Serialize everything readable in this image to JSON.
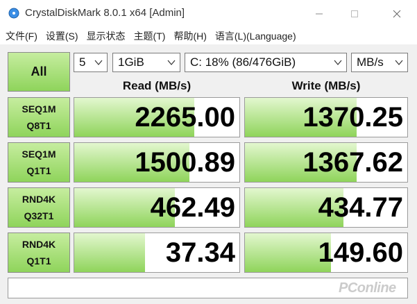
{
  "window": {
    "title": "CrystalDiskMark 8.0.1 x64 [Admin]",
    "icon": "disk-icon"
  },
  "menu": [
    "文件(F)",
    "设置(S)",
    "显示状态",
    "主题(T)",
    "帮助(H)",
    "语言(L)(Language)"
  ],
  "toolbar": {
    "all_label": "All",
    "count": "5",
    "size": "1GiB",
    "drive": "C: 18% (86/476GiB)",
    "unit": "MB/s"
  },
  "headers": {
    "read": "Read (MB/s)",
    "write": "Write (MB/s)"
  },
  "tests": [
    {
      "line1": "SEQ1M",
      "line2": "Q8T1",
      "read": "2265.00",
      "write": "1370.25"
    },
    {
      "line1": "SEQ1M",
      "line2": "Q1T1",
      "read": "1500.89",
      "write": "1367.62"
    },
    {
      "line1": "RND4K",
      "line2": "Q32T1",
      "read": "462.49",
      "write": "434.77"
    },
    {
      "line1": "RND4K",
      "line2": "Q1T1",
      "read": "37.34",
      "write": "149.60"
    }
  ],
  "comment": "",
  "watermark": "PConline",
  "colors": {
    "accent_green": "#8fd45b",
    "panel_bg": "#f0f0f0"
  }
}
